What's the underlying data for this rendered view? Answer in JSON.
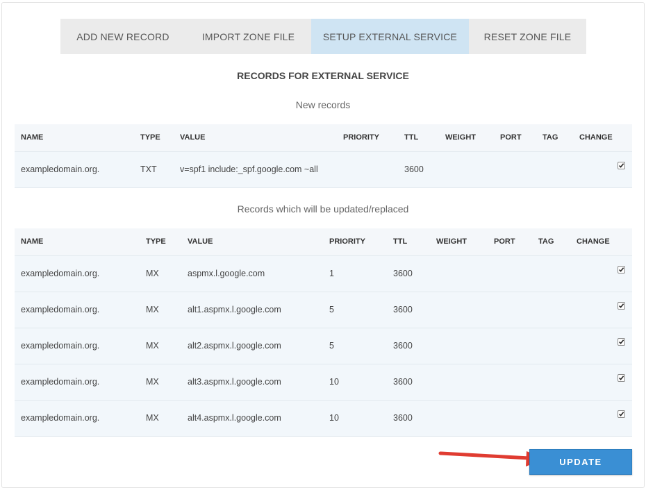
{
  "tabs": [
    {
      "label": "ADD NEW RECORD",
      "active": false
    },
    {
      "label": "IMPORT ZONE FILE",
      "active": false
    },
    {
      "label": "SETUP EXTERNAL SERVICE",
      "active": true
    },
    {
      "label": "RESET ZONE FILE",
      "active": false
    }
  ],
  "section_title": "RECORDS FOR EXTERNAL SERVICE",
  "new_records": {
    "title": "New records",
    "columns": [
      "NAME",
      "TYPE",
      "VALUE",
      "PRIORITY",
      "TTL",
      "WEIGHT",
      "PORT",
      "TAG",
      "CHANGE"
    ],
    "rows": [
      {
        "name": "exampledomain.org.",
        "type": "TXT",
        "value": "v=spf1 include:_spf.google.com ~all",
        "priority": "",
        "ttl": "3600",
        "weight": "",
        "port": "",
        "tag": "",
        "change": true
      }
    ]
  },
  "replaced_records": {
    "title": "Records which will be updated/replaced",
    "columns": [
      "NAME",
      "TYPE",
      "VALUE",
      "PRIORITY",
      "TTL",
      "WEIGHT",
      "PORT",
      "TAG",
      "CHANGE"
    ],
    "rows": [
      {
        "name": "exampledomain.org.",
        "type": "MX",
        "value": "aspmx.l.google.com",
        "priority": "1",
        "ttl": "3600",
        "weight": "",
        "port": "",
        "tag": "",
        "change": true
      },
      {
        "name": "exampledomain.org.",
        "type": "MX",
        "value": "alt1.aspmx.l.google.com",
        "priority": "5",
        "ttl": "3600",
        "weight": "",
        "port": "",
        "tag": "",
        "change": true
      },
      {
        "name": "exampledomain.org.",
        "type": "MX",
        "value": "alt2.aspmx.l.google.com",
        "priority": "5",
        "ttl": "3600",
        "weight": "",
        "port": "",
        "tag": "",
        "change": true
      },
      {
        "name": "exampledomain.org.",
        "type": "MX",
        "value": "alt3.aspmx.l.google.com",
        "priority": "10",
        "ttl": "3600",
        "weight": "",
        "port": "",
        "tag": "",
        "change": true
      },
      {
        "name": "exampledomain.org.",
        "type": "MX",
        "value": "alt4.aspmx.l.google.com",
        "priority": "10",
        "ttl": "3600",
        "weight": "",
        "port": "",
        "tag": "",
        "change": true
      }
    ]
  },
  "update_button": {
    "label": "UPDATE"
  },
  "colors": {
    "active_tab": "#cfe4f3",
    "button": "#3a8fd4",
    "arrow": "#e03c31"
  },
  "icons": {
    "checkbox": "checkbox-checked-icon",
    "arrow": "red-arrow-icon"
  }
}
